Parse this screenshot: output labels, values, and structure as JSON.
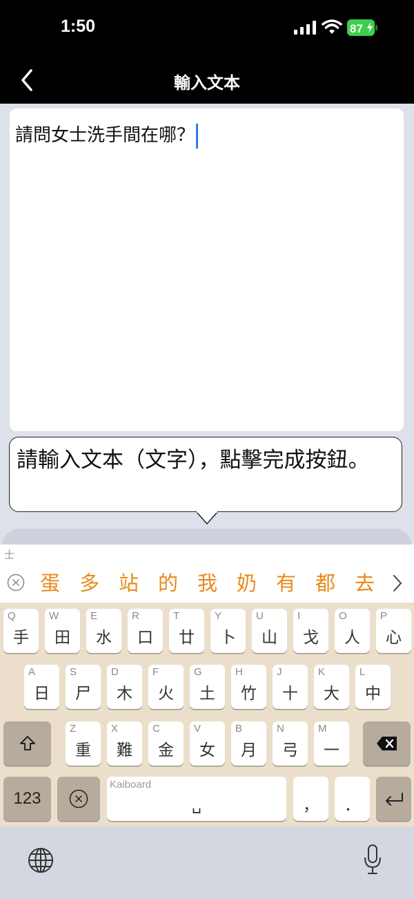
{
  "status_bar": {
    "time": "1:50",
    "battery": "87"
  },
  "nav": {
    "title": "輸入文本"
  },
  "editor": {
    "text": "請問女士洗手間在哪？"
  },
  "tooltip": {
    "text": "請輸入文本（文字），點擊完成按鈕。"
  },
  "keyboard": {
    "composition": "士",
    "candidates": [
      "蛋",
      "多",
      "站",
      "的",
      "我",
      "奶",
      "有",
      "都",
      "去"
    ],
    "row1": [
      {
        "letter": "Q",
        "radical": "手"
      },
      {
        "letter": "W",
        "radical": "田"
      },
      {
        "letter": "E",
        "radical": "水"
      },
      {
        "letter": "R",
        "radical": "口"
      },
      {
        "letter": "T",
        "radical": "廿"
      },
      {
        "letter": "Y",
        "radical": "卜"
      },
      {
        "letter": "U",
        "radical": "山"
      },
      {
        "letter": "I",
        "radical": "戈"
      },
      {
        "letter": "O",
        "radical": "人"
      },
      {
        "letter": "P",
        "radical": "心"
      }
    ],
    "row2": [
      {
        "letter": "A",
        "radical": "日"
      },
      {
        "letter": "S",
        "radical": "尸"
      },
      {
        "letter": "D",
        "radical": "木"
      },
      {
        "letter": "F",
        "radical": "火"
      },
      {
        "letter": "G",
        "radical": "土"
      },
      {
        "letter": "H",
        "radical": "竹"
      },
      {
        "letter": "J",
        "radical": "十"
      },
      {
        "letter": "K",
        "radical": "大"
      },
      {
        "letter": "L",
        "radical": "中"
      }
    ],
    "row3": [
      {
        "letter": "Z",
        "radical": "重"
      },
      {
        "letter": "X",
        "radical": "難"
      },
      {
        "letter": "C",
        "radical": "金"
      },
      {
        "letter": "V",
        "radical": "女"
      },
      {
        "letter": "B",
        "radical": "月"
      },
      {
        "letter": "N",
        "radical": "弓"
      },
      {
        "letter": "M",
        "radical": "一"
      }
    ],
    "numbers_label": "123",
    "space_label": "Kaiboard",
    "space_glyph": "␣",
    "comma": "，",
    "period": "．",
    "icons": {
      "shift": "shift-icon",
      "delete": "delete-icon",
      "clear": "clear-icon",
      "return": "return-icon",
      "globe": "globe-icon",
      "mic": "microphone-icon"
    },
    "accent_color": "#e88a1a"
  }
}
